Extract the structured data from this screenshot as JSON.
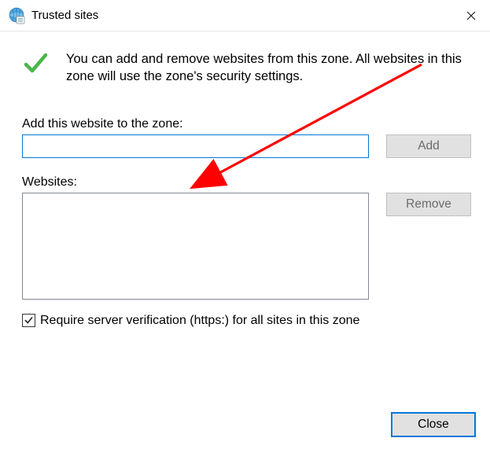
{
  "titlebar": {
    "title": "Trusted sites"
  },
  "info": {
    "text": "You can add and remove websites from this zone. All websites in this zone will use the zone's security settings."
  },
  "addSection": {
    "label": "Add this website to the zone:",
    "inputValue": "",
    "addButton": "Add"
  },
  "websitesSection": {
    "label": "Websites:",
    "items": [],
    "removeButton": "Remove"
  },
  "checkbox": {
    "checked": true,
    "label": "Require server verification (https:) for all sites in this zone"
  },
  "footer": {
    "closeButton": "Close"
  }
}
